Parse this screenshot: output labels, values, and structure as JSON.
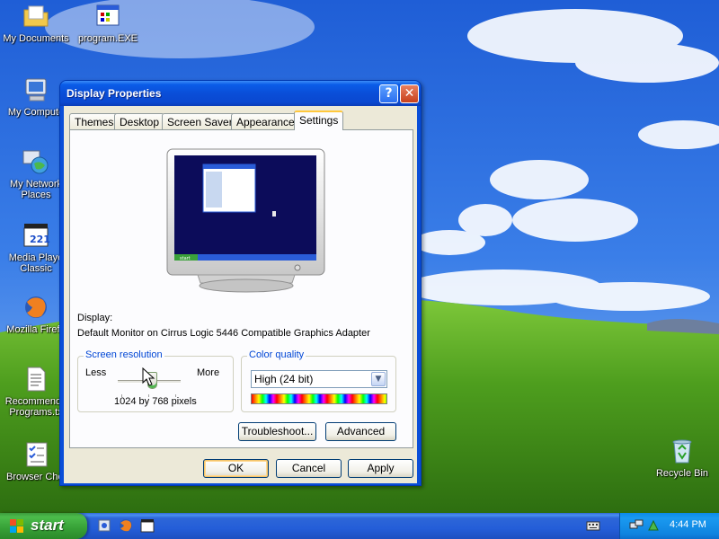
{
  "desktop": {
    "icons": [
      {
        "label": "My Documents"
      },
      {
        "label": "program.EXE"
      },
      {
        "label": "My Compute"
      },
      {
        "label": "My Network Places"
      },
      {
        "label": "Media Playe Classic"
      },
      {
        "label": "Mozilla Firefo"
      },
      {
        "label": "Recommende Programs.tx"
      },
      {
        "label": "Browser Choi"
      },
      {
        "label": "Recycle Bin"
      }
    ]
  },
  "window": {
    "title": "Display Properties",
    "help_glyph": "?",
    "close_glyph": "✕",
    "tabs": [
      "Themes",
      "Desktop",
      "Screen Saver",
      "Appearance",
      "Settings"
    ],
    "active_tab": "Settings",
    "preview_start_label": "start",
    "display_label": "Display:",
    "display_value": "Default Monitor on Cirrus Logic 5446 Compatible Graphics Adapter",
    "screen_resolution": {
      "legend": "Screen resolution",
      "less_label": "Less",
      "more_label": "More",
      "value_text": "1024 by 768 pixels",
      "slider_level": 0.55
    },
    "color_quality": {
      "legend": "Color quality",
      "selected": "High (24 bit)"
    },
    "buttons": {
      "troubleshoot": "Troubleshoot...",
      "advanced": "Advanced",
      "ok": "OK",
      "cancel": "Cancel",
      "apply": "Apply"
    }
  },
  "taskbar": {
    "start_label": "start",
    "clock": "4:44 PM"
  },
  "colors": {
    "title_blue": "#0a4ed8",
    "legend_blue": "#0046d5",
    "start_green": "#36a036",
    "dialog_bg": "#ece9d8"
  }
}
